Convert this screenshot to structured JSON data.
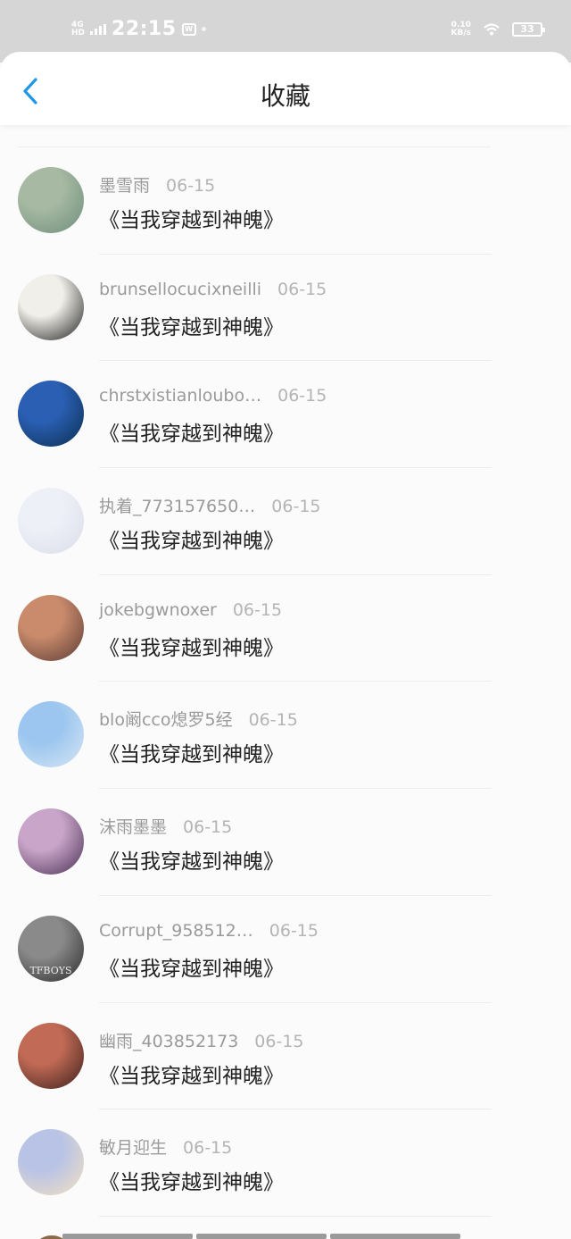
{
  "status_bar": {
    "network_label": "4G",
    "network_sublabel": "HD",
    "time": "22:15",
    "notification_icon_letter": "W",
    "speed_value": "0.10",
    "speed_unit": "KB/s",
    "battery": "33"
  },
  "header": {
    "title": "收藏",
    "back_icon": "chevron-left-icon"
  },
  "favorites": [
    {
      "username": "墨雪雨",
      "date": "06-15",
      "title": "《当我穿越到神魄》",
      "avatar_colors": [
        "#a7b9a2",
        "#6c8e7b"
      ]
    },
    {
      "username": "brunsellocucixneilli",
      "date": "06-15",
      "title": "《当我穿越到神魄》",
      "avatar_colors": [
        "#f0efe9",
        "#1d1d1d"
      ]
    },
    {
      "username": "chrstxistianloubo…",
      "date": "06-15",
      "title": "《当我穿越到神魄》",
      "avatar_colors": [
        "#2a5fb3",
        "#0b2e4f"
      ]
    },
    {
      "username": "执着_773157650…",
      "date": "06-15",
      "title": "《当我穿越到神魄》",
      "avatar_colors": [
        "#eef0f8",
        "#d9dde8"
      ]
    },
    {
      "username": "jokebgwnoxer",
      "date": "06-15",
      "title": "《当我穿越到神魄》",
      "avatar_colors": [
        "#c98b6c",
        "#5a3a33"
      ]
    },
    {
      "username": "blo阚cco熄罗5经",
      "date": "06-15",
      "title": "《当我穿越到神魄》",
      "avatar_colors": [
        "#9cc6ef",
        "#d7e6f4"
      ]
    },
    {
      "username": "沫雨墨墨",
      "date": "06-15",
      "title": "《当我穿越到神魄》",
      "avatar_colors": [
        "#c9a6c9",
        "#4a2f55"
      ]
    },
    {
      "username": "Corrupt_958512…",
      "date": "06-15",
      "title": "《当我穿越到神魄》",
      "avatar_colors": [
        "#8a8a8a",
        "#2b2b2b"
      ],
      "avatar_text": "TFBOYS"
    },
    {
      "username": "幽雨_403852173",
      "date": "06-15",
      "title": "《当我穿越到神魄》",
      "avatar_colors": [
        "#c16a55",
        "#3a1f1a"
      ]
    },
    {
      "username": "敏月迎生",
      "date": "06-15",
      "title": "《当我穿越到神魄》",
      "avatar_colors": [
        "#b9c3e6",
        "#f3e1c0"
      ]
    }
  ]
}
